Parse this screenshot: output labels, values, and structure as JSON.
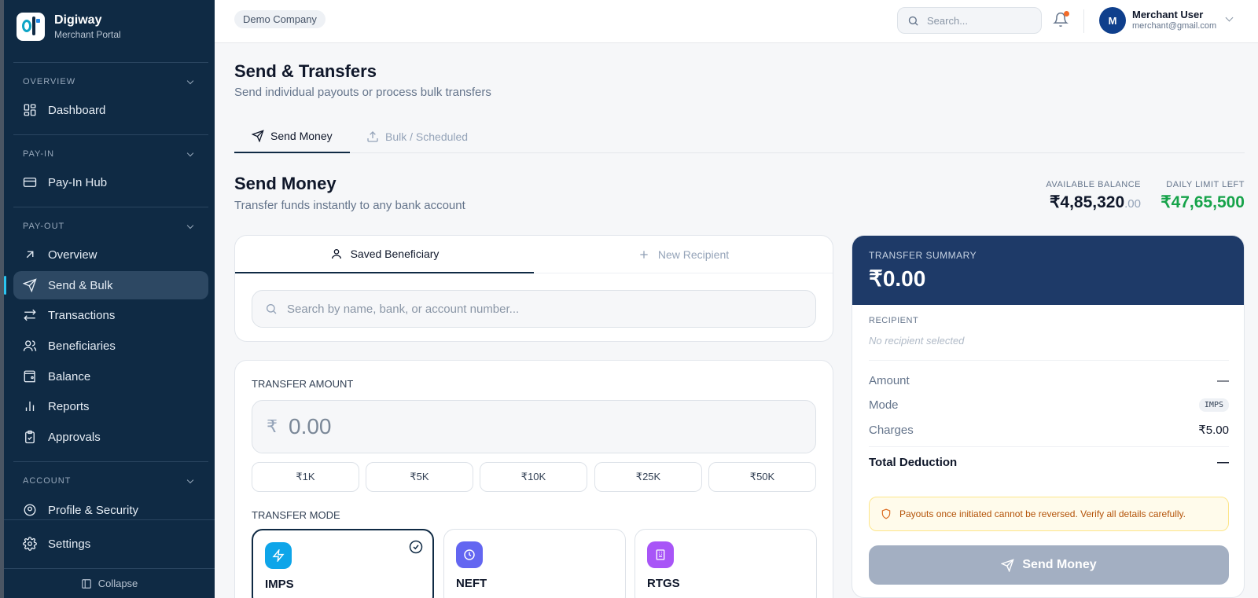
{
  "brand": {
    "name": "Digiway",
    "subtitle": "Merchant Portal"
  },
  "sidebar": {
    "sections": [
      {
        "label": "OVERVIEW"
      },
      {
        "label": "PAY-IN"
      },
      {
        "label": "PAY-OUT"
      },
      {
        "label": "ACCOUNT"
      }
    ],
    "items": [
      {
        "label": "Dashboard",
        "icon": "grid-icon"
      },
      {
        "label": "Pay-In Hub",
        "icon": "card-icon"
      },
      {
        "label": "Overview",
        "icon": "arrow-up-right-icon"
      },
      {
        "label": "Send & Bulk",
        "icon": "send-icon",
        "active": true
      },
      {
        "label": "Transactions",
        "icon": "transfer-arrows-icon"
      },
      {
        "label": "Beneficiaries",
        "icon": "users-icon"
      },
      {
        "label": "Balance",
        "icon": "wallet-icon"
      },
      {
        "label": "Reports",
        "icon": "bar-chart-icon"
      },
      {
        "label": "Approvals",
        "icon": "clipboard-check-icon"
      },
      {
        "label": "Profile & Security",
        "icon": "user-circle-icon"
      },
      {
        "label": "Settings",
        "icon": "gear-icon"
      }
    ],
    "collapse_label": "Collapse"
  },
  "topbar": {
    "company": "Demo Company",
    "search_placeholder": "Search...",
    "user": {
      "initial": "M",
      "name": "Merchant User",
      "email": "merchant@gmail.com"
    }
  },
  "page": {
    "title": "Send & Transfers",
    "subtitle": "Send individual payouts or process bulk transfers",
    "tabs": [
      {
        "label": "Send Money"
      },
      {
        "label": "Bulk / Scheduled"
      }
    ]
  },
  "send": {
    "title": "Send Money",
    "subtitle": "Transfer funds instantly to any bank account",
    "available_balance_label": "AVAILABLE BALANCE",
    "available_balance": "₹4,85,320",
    "available_balance_paise": ".00",
    "daily_limit_label": "DAILY LIMIT LEFT",
    "daily_limit": "₹47,65,500",
    "recipient_tabs": [
      {
        "label": "Saved Beneficiary"
      },
      {
        "label": "New Recipient"
      }
    ],
    "beneficiary_search_placeholder": "Search by name, bank, or account number...",
    "amount_label": "TRANSFER AMOUNT",
    "currency_symbol": "₹",
    "amount_placeholder": "0.00",
    "quick_amounts": [
      "₹1K",
      "₹5K",
      "₹10K",
      "₹25K",
      "₹50K"
    ],
    "mode_label": "TRANSFER MODE",
    "modes": [
      {
        "name": "IMPS",
        "icon": "lightning-icon",
        "color": "#0ea5e9",
        "selected": true
      },
      {
        "name": "NEFT",
        "icon": "clock-icon",
        "color": "#6366f1"
      },
      {
        "name": "RTGS",
        "icon": "building-icon",
        "color": "#a855f7"
      }
    ]
  },
  "summary": {
    "header_label": "TRANSFER SUMMARY",
    "total": "₹0.00",
    "recipient_label": "RECIPIENT",
    "recipient_value": "No recipient selected",
    "rows": [
      {
        "label": "Amount",
        "value": "—"
      },
      {
        "label": "Mode",
        "value": "IMPS"
      },
      {
        "label": "Charges",
        "value": "₹5.00"
      }
    ],
    "total_deduction_label": "Total Deduction",
    "total_deduction_value": "—",
    "warning": "Payouts once initiated cannot be reversed. Verify all details carefully.",
    "send_button": "Send Money"
  },
  "colors": {
    "sidebar_bg": "#0f2a44",
    "accent": "#2ac4f0",
    "limit_green": "#16a34a",
    "summary_header": "#1e3a68"
  }
}
